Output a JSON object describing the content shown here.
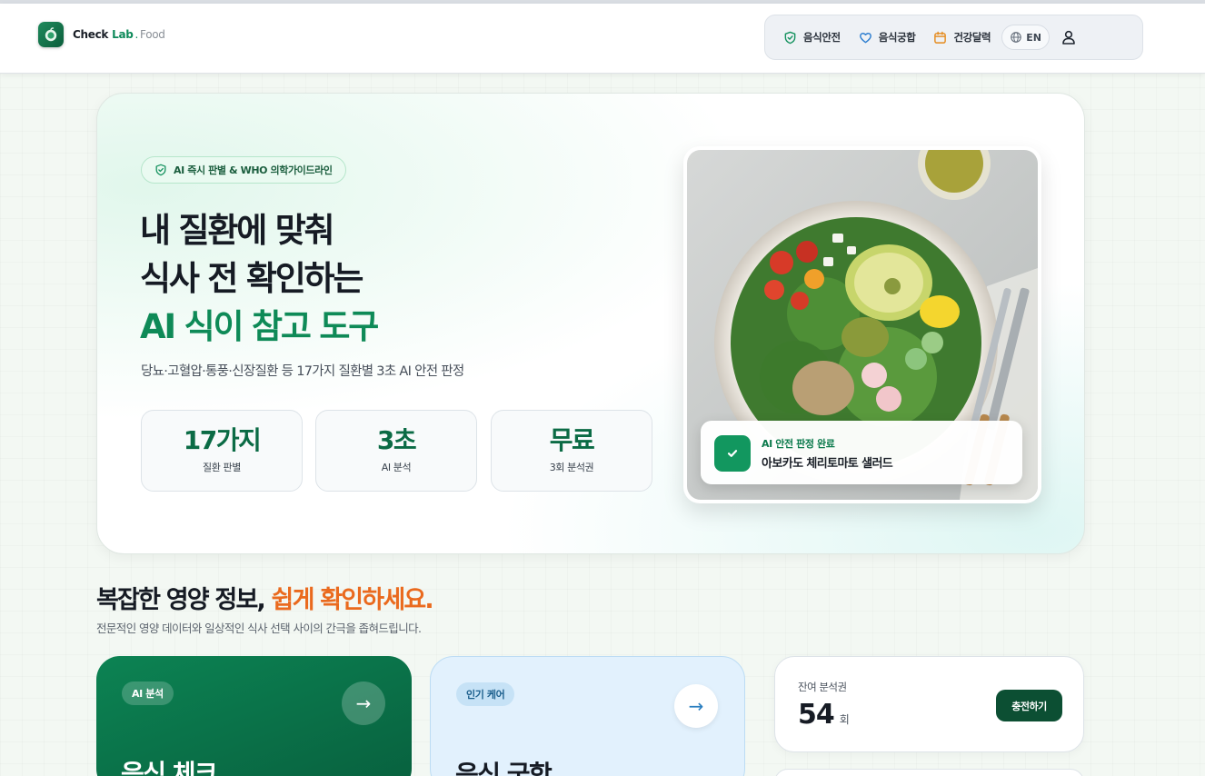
{
  "header": {
    "logo": {
      "check": "Check",
      "lab": "Lab",
      "dot": ".",
      "food": "Food"
    },
    "nav": [
      {
        "label": "음식안전",
        "icon": "shield-check-icon"
      },
      {
        "label": "음식궁합",
        "icon": "heart-icon"
      },
      {
        "label": "건강달력",
        "icon": "calendar-icon"
      }
    ],
    "lang": {
      "label": "EN",
      "icon": "globe-icon"
    },
    "user_icon": "user-icon"
  },
  "hero": {
    "badge": "AI 즉시 판별 & WHO 의학가이드라인",
    "title_line1": "내 질환에 맞춰",
    "title_line2": "식사 전 확인하는",
    "title_line3": "AI 식이 참고 도구",
    "subtitle": "당뇨·고혈압·통풍·신장질환 등 17가지 질환별 3초 AI 안전 판정",
    "stats": [
      {
        "value": "17가지",
        "label": "질환 판별"
      },
      {
        "value": "3초",
        "label": "AI 분석"
      },
      {
        "value": "무료",
        "label": "3회 분석권"
      }
    ],
    "result": {
      "status": "AI 안전 판정 완료",
      "food": "아보카도 체리토마토 샐러드"
    }
  },
  "section": {
    "title_main": "복잡한 영양 정보,",
    "title_accent": "쉽게 확인하세요.",
    "subtitle": "전문적인 영양 데이터와 일상적인 식사 선택 사이의 간극을 좁혀드립니다."
  },
  "cards": [
    {
      "tag": "AI 분석",
      "title": "음식 체크",
      "arrow": "→"
    },
    {
      "tag": "인기 케어",
      "title": "음식 궁합",
      "arrow": "→"
    }
  ],
  "credit": {
    "label": "잔여 분석권",
    "count": "54",
    "unit": "회",
    "button": "충전하기"
  },
  "colors": {
    "brand_green": "#0e8a57",
    "accent_orange": "#ea6a1e",
    "card_blue": "#e2f1fd",
    "button_dark": "#0c4f33"
  }
}
